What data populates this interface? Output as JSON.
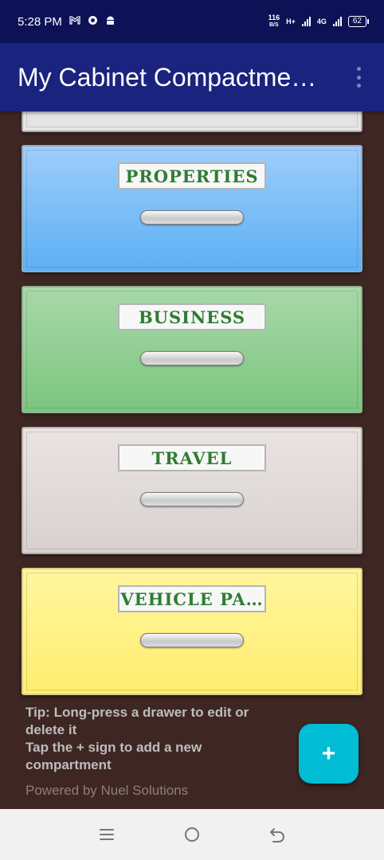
{
  "status_bar": {
    "time": "5:28 PM",
    "icons": [
      "gmail-icon",
      "chrome-icon",
      "android-icon"
    ],
    "net_speed_value": "116",
    "net_speed_unit": "B/S",
    "network_type_1": "H+",
    "network_type_2": "4G",
    "battery": "62"
  },
  "app_bar": {
    "title": "My Cabinet Compactme…",
    "menu_icon": "more-vertical-icon"
  },
  "drawers": [
    {
      "label": "",
      "color": "#e4e4e4"
    },
    {
      "label": "PROPERTIES",
      "color": "#64b5f6"
    },
    {
      "label": "BUSINESS",
      "color": "#81c784"
    },
    {
      "label": "TRAVEL",
      "color": "#d7ccc8"
    },
    {
      "label": "VEHICLE PA…",
      "color": "#fff176"
    }
  ],
  "tips": {
    "line1": "Tip: Long-press a drawer to edit or delete it",
    "line2": "Tap the + sign to add a new compartment"
  },
  "footer": {
    "powered_by": "Powered by Nuel Solutions"
  },
  "fab": {
    "label": "+",
    "color": "#00bcd4"
  },
  "nav_bar": {
    "icons": [
      "recents-menu-icon",
      "home-circle-icon",
      "back-arrow-icon"
    ]
  },
  "colors": {
    "status_bar": "#0d1257",
    "app_bar": "#1a237e",
    "background": "#3e2723",
    "label_text": "#2e7d32"
  }
}
